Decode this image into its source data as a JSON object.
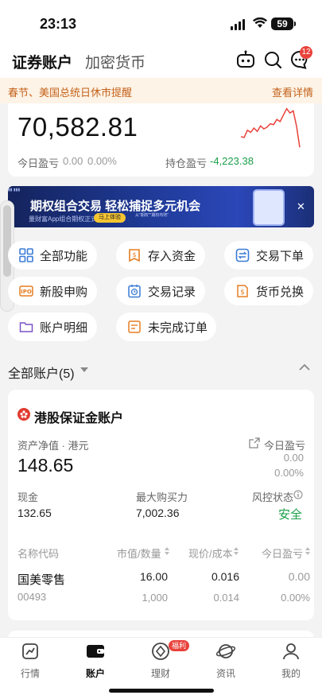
{
  "status": {
    "time": "23:13",
    "battery": "59"
  },
  "header": {
    "tabs": [
      {
        "label": "证券账户"
      },
      {
        "label": "加密货币"
      }
    ],
    "message_badge": "12"
  },
  "notice": {
    "text": "春节、美国总统日休市提醒",
    "link": "查看详情"
  },
  "summary": {
    "total_value": "70,582.81",
    "today_pl_label": "今日盈亏",
    "today_pl_value": "0.00",
    "today_pl_pct": "0.00%",
    "position_pl_label": "持仓盈亏",
    "position_pl_value": "-4,223.38",
    "sparkline": [
      0.3,
      0.28,
      0.45,
      0.4,
      0.5,
      0.42,
      0.55,
      0.48,
      0.52,
      0.6,
      0.58,
      0.7,
      0.65,
      0.8,
      0.95,
      0.85,
      0.9,
      0.55,
      0.05
    ],
    "sparkline_color": "#e8423b"
  },
  "banner": {
    "title": "期权组合交易 轻松捕捉多元机会",
    "subtitle": "量财富App组合期权正式上线",
    "button": "马上体验",
    "mini_text": "从\"期权\"\"期权布阵\""
  },
  "actions": [
    {
      "label": "全部功能",
      "icon": "grid-icon"
    },
    {
      "label": "存入资金",
      "icon": "deposit-icon"
    },
    {
      "label": "交易下单",
      "icon": "trade-icon"
    },
    {
      "label": "新股申购",
      "icon": "ipo-icon"
    },
    {
      "label": "交易记录",
      "icon": "record-icon"
    },
    {
      "label": "货币兑换",
      "icon": "exchange-icon"
    },
    {
      "label": "账户明细",
      "icon": "folder-icon"
    },
    {
      "label": "未完成订单",
      "icon": "order-icon"
    }
  ],
  "accounts": {
    "header": "全部账户(5)",
    "card": {
      "title": "港股保证金账户",
      "net_assets_label": "资产净值 · 港元",
      "net_assets": "148.65",
      "today_pl_label": "今日盈亏",
      "today_pl_value": "0.00",
      "today_pl_pct": "0.00%",
      "cash_label": "现金",
      "cash": "132.65",
      "buying_power_label": "最大购买力",
      "buying_power": "7,002.36",
      "risk_label": "风控状态",
      "risk_value": "安全",
      "columns": [
        "名称代码",
        "市值/数量",
        "现价/成本",
        "今日盈亏"
      ],
      "holdings": [
        {
          "name": "国美零售",
          "code": "00493",
          "market_value": "16.00",
          "quantity": "1,000",
          "price": "0.016",
          "cost": "0.014",
          "pl": "0.00",
          "pl_pct": "0.00%"
        }
      ]
    }
  },
  "tabbar": {
    "items": [
      {
        "label": "行情"
      },
      {
        "label": "账户"
      },
      {
        "label": "理财"
      },
      {
        "label": "资讯"
      },
      {
        "label": "我的"
      }
    ],
    "badge": "福利"
  },
  "colors": {
    "brand_red": "#e8423b",
    "green": "#1a9e4a",
    "orange": "#e67e22"
  }
}
